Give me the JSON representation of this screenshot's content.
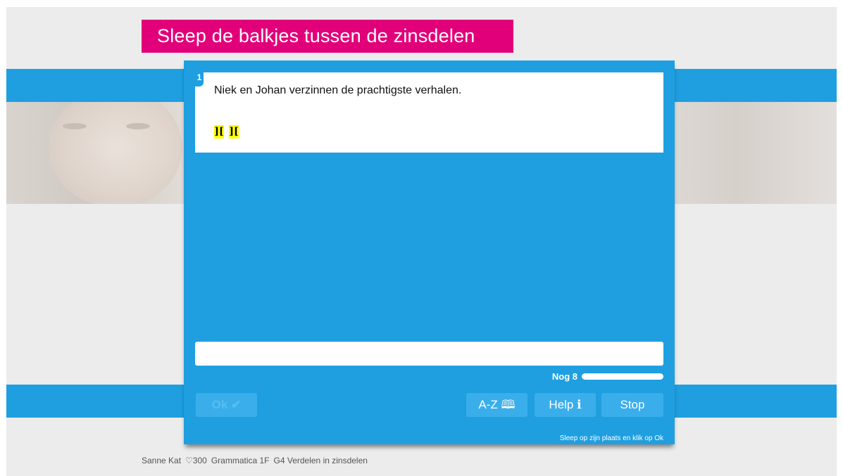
{
  "title": "Sleep de balkjes tussen de zinsdelen",
  "question": {
    "number": "1",
    "sentence": "Niek en Johan verzinnen de prachtigste verhalen.",
    "markers": [
      "][",
      "]["
    ]
  },
  "progress": {
    "label": "Nog 8",
    "fraction": 1.0
  },
  "buttons": {
    "ok": "Ok ✔",
    "az": "A-Z 🕮",
    "help": "Help ℹ",
    "stop": "Stop"
  },
  "hint": "Sleep op zijn plaats en klik op Ok",
  "footer": {
    "user": "Sanne Kat",
    "score": "♡300",
    "course": "Grammatica 1F",
    "lesson": "G4 Verdelen in zinsdelen"
  },
  "colors": {
    "accent_blue": "#1f9fe0",
    "title_pink": "#e2007a",
    "marker_yellow": "#ffff00"
  }
}
